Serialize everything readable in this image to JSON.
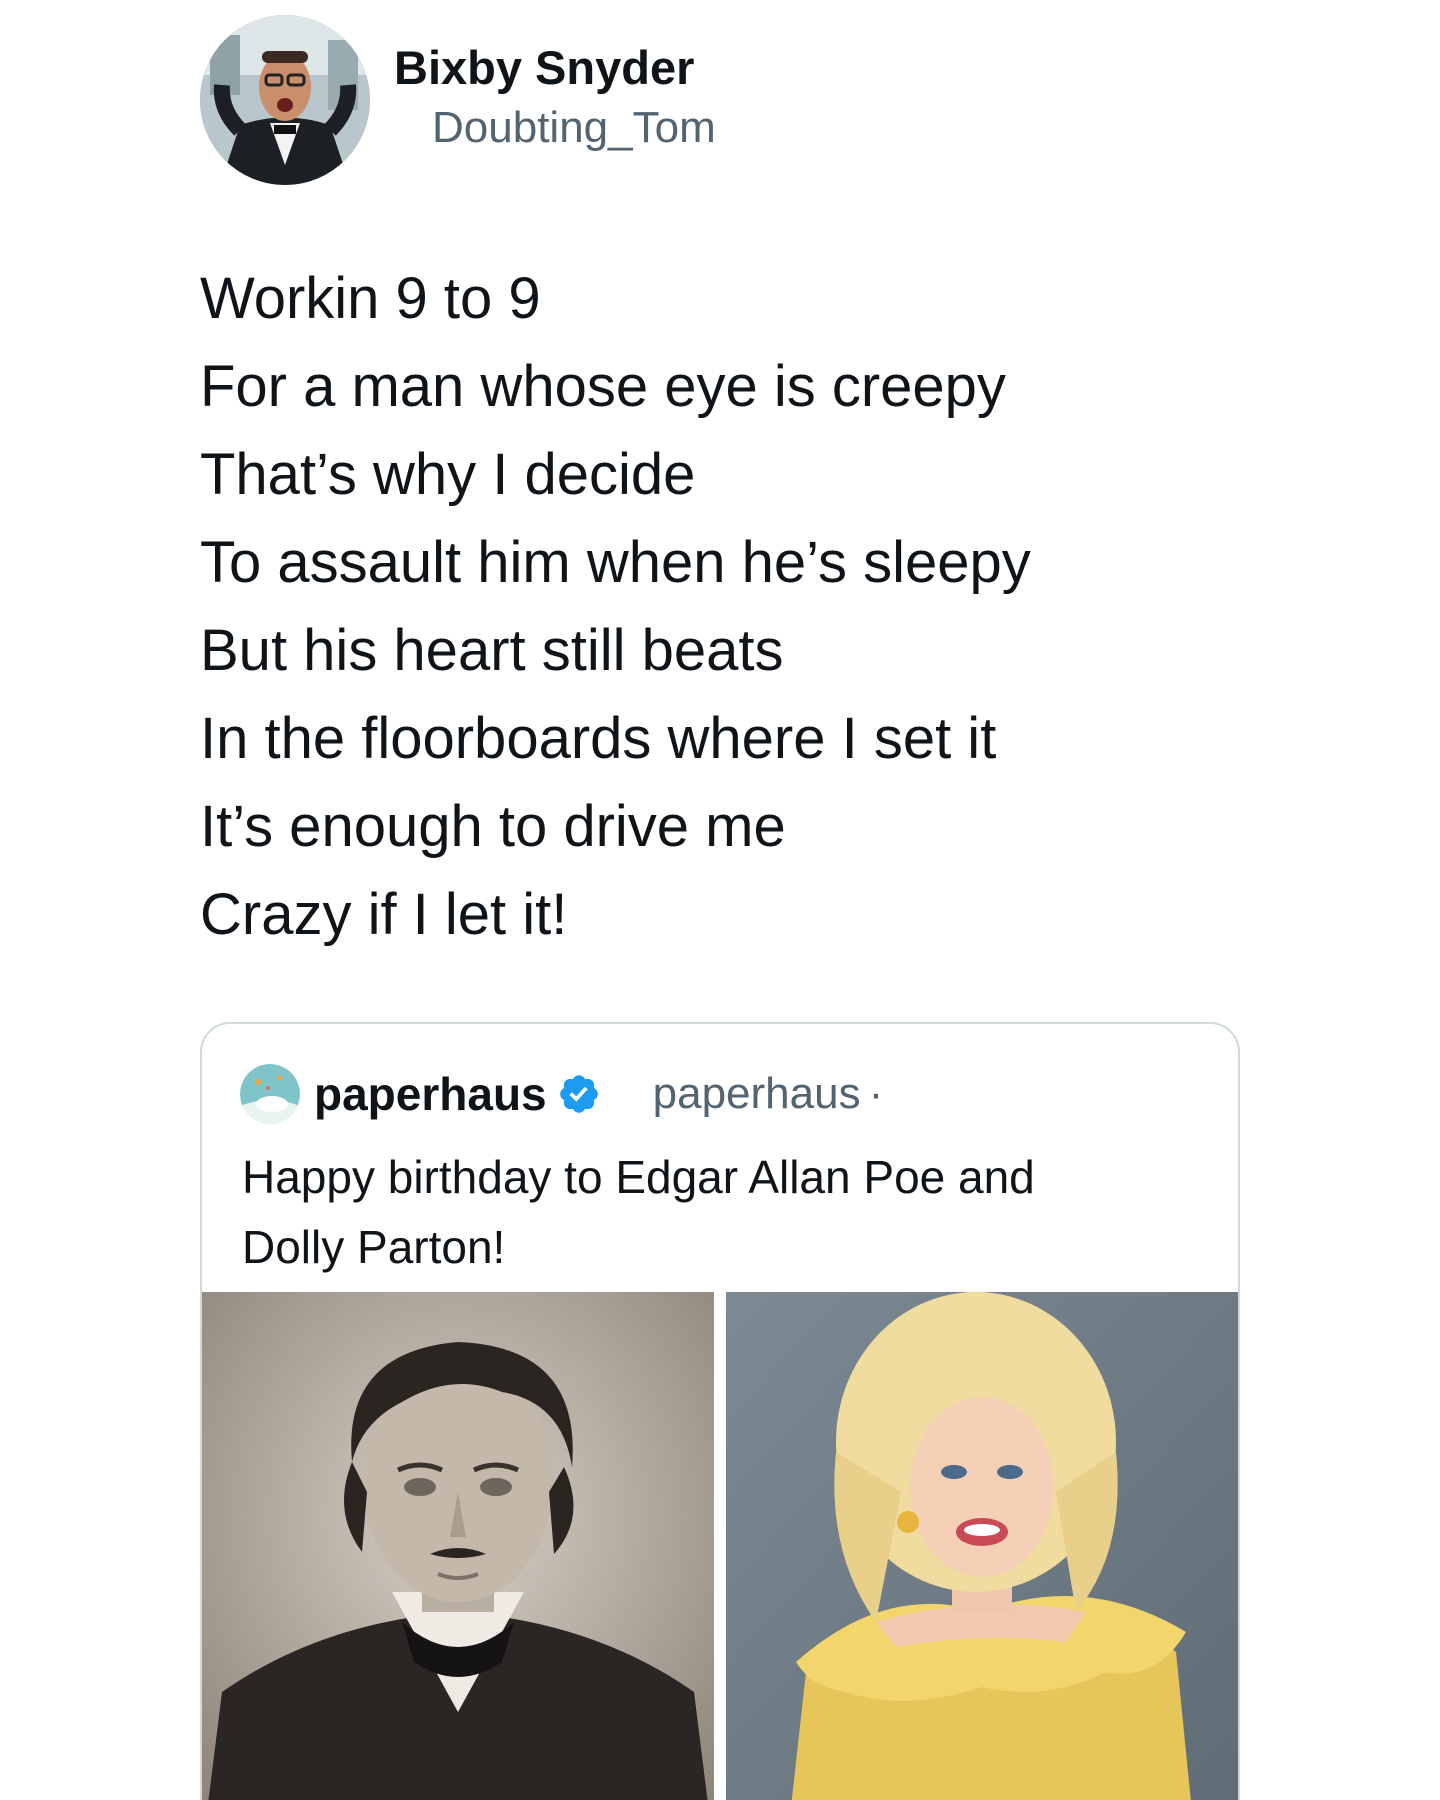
{
  "tweet": {
    "author": {
      "display_name": "Bixby Snyder",
      "handle": "Doubting_Tom",
      "avatar_icon": "profile-photo"
    },
    "text_lines": [
      "Workin 9 to 9",
      "For a man whose eye is creepy",
      "That’s why I decide",
      "To assault him when he’s sleepy",
      "But his heart still beats",
      "In the floorboards where I set it",
      "It’s enough to drive me",
      "Crazy if I let it!"
    ]
  },
  "quoted_tweet": {
    "author": {
      "display_name": "paperhaus",
      "handle": "paperhaus",
      "separator": "·",
      "verified": true,
      "verified_icon": "verified-badge-icon",
      "avatar_icon": "profile-photo"
    },
    "text_lines": [
      "Happy birthday to Edgar Allan Poe and",
      "Dolly Parton!"
    ],
    "media": [
      {
        "icon": "photo-portrait-sepia"
      },
      {
        "icon": "photo-portrait-color"
      }
    ]
  },
  "colors": {
    "text_primary": "#0f1419",
    "text_secondary": "#536471",
    "card_border": "#cfd9de",
    "verified_blue": "#1d9bf0"
  }
}
